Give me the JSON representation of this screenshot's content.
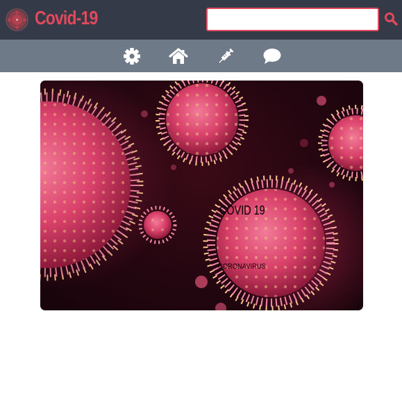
{
  "header": {
    "brand": "Covid-19",
    "search": {
      "value": "",
      "placeholder": ""
    },
    "search_icon": "search-icon",
    "logo_icon": "virus-logo-icon"
  },
  "nav": {
    "items": [
      {
        "icon": "gear-icon"
      },
      {
        "icon": "home-icon"
      },
      {
        "icon": "syringe-icon"
      },
      {
        "icon": "chat-bubble-icon"
      }
    ]
  },
  "hero": {
    "title": "COVID 19",
    "subtitle": "CORONAVIRUS"
  },
  "colors": {
    "accent": "#e04a5c",
    "topbar": "#343a48",
    "navbar": "#6f7a89",
    "icon": "#ffffff"
  }
}
